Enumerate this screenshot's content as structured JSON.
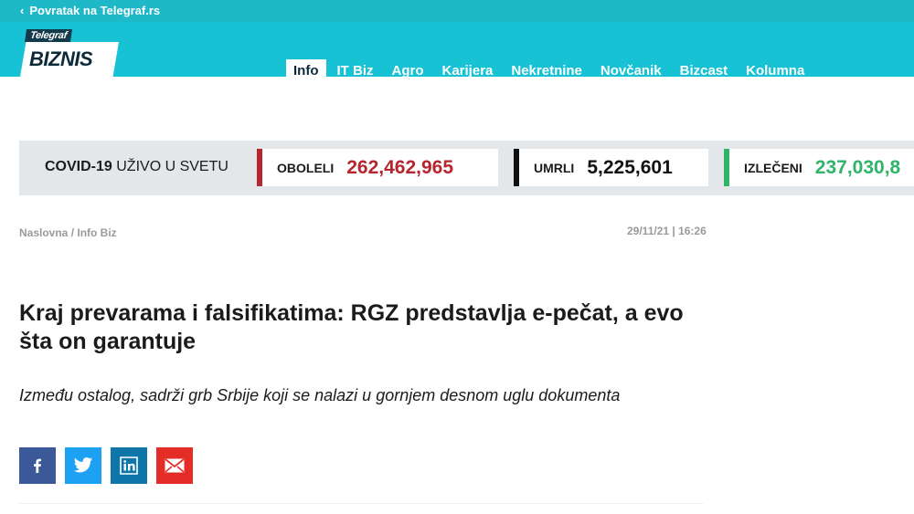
{
  "topbar": {
    "back_label": "Povratak na Telegraf.rs"
  },
  "logo": {
    "top_text": "Telegraf",
    "main_text": "BIZNIS"
  },
  "nav": {
    "items": [
      {
        "label": "Info",
        "active": true
      },
      {
        "label": "IT Biz",
        "active": false
      },
      {
        "label": "Agro",
        "active": false
      },
      {
        "label": "Karijera",
        "active": false
      },
      {
        "label": "Nekretnine",
        "active": false
      },
      {
        "label": "Novčanik",
        "active": false
      },
      {
        "label": "Bizcast",
        "active": false
      },
      {
        "label": "Kolumna",
        "active": false
      }
    ]
  },
  "covid": {
    "title_bold": "COVID-19",
    "title_rest": " UŽIVO U SVETU",
    "stats": [
      {
        "label": "OBOLELI",
        "value": "262,462,965",
        "color": "#b5262e"
      },
      {
        "label": "UMRLI",
        "value": "5,225,601",
        "color": "#111111"
      },
      {
        "label": "IZLEČENI",
        "value": "237,030,8",
        "color": "#2fb468"
      }
    ]
  },
  "article": {
    "breadcrumb": "Naslovna / Info Biz",
    "date": "29/11/21 | 16:26",
    "title": "Kraj prevarama i falsifikatima: RGZ predstavlja e-pečat, a evo šta on garantuje",
    "lead": "Između ostalog, sadrži grb Srbije koji se nalazi u gornjem desnom uglu dokumenta"
  },
  "share": {
    "buttons": [
      {
        "icon": "facebook-icon",
        "color": "#3b5998"
      },
      {
        "icon": "twitter-icon",
        "color": "#1da1f2"
      },
      {
        "icon": "linkedin-icon",
        "color": "#0e76a8"
      },
      {
        "icon": "email-icon",
        "color": "#e52d27"
      }
    ]
  }
}
